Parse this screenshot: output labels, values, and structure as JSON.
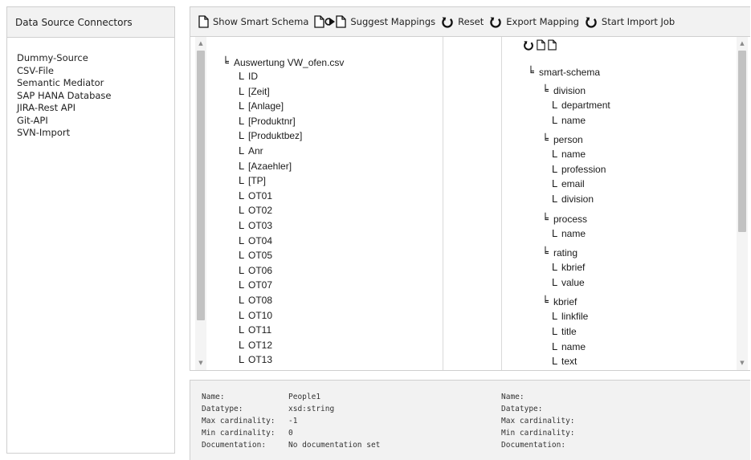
{
  "sidebar": {
    "title": "Data Source Connectors",
    "items": [
      "Dummy-Source",
      "CSV-File",
      "Semantic Mediator",
      "SAP HANA Database",
      "JIRA-Rest API",
      "Git-API",
      "SVN-Import"
    ]
  },
  "toolbar": {
    "show_smart_schema": "Show Smart Schema",
    "suggest_mappings": "Suggest Mappings",
    "reset": "Reset",
    "export_mapping": "Export Mapping",
    "start_import_job": "Start Import Job"
  },
  "source_tree": {
    "root": "Auswertung VW_ofen.csv",
    "children": [
      "ID",
      "[Zeit]",
      "[Anlage]",
      "[Produktnr]",
      "[Produktbez]",
      "Anr",
      "[Azaehler]",
      "[TP]",
      "OT01",
      "OT02",
      "OT03",
      "OT04",
      "OT05",
      "OT06",
      "OT07",
      "OT08",
      "OT10",
      "OT11",
      "OT12",
      "OT13"
    ]
  },
  "target_tree": {
    "root": "smart-schema",
    "groups": [
      {
        "name": "division",
        "children": [
          "department",
          "name"
        ]
      },
      {
        "name": "person",
        "children": [
          "name",
          "profession",
          "email",
          "division"
        ]
      },
      {
        "name": "process",
        "children": [
          "name"
        ]
      },
      {
        "name": "rating",
        "children": [
          "kbrief",
          "value"
        ]
      },
      {
        "name": "kbrief",
        "children": [
          "linkfile",
          "title",
          "name",
          "text"
        ]
      }
    ]
  },
  "source_info": {
    "labels": [
      "Name:",
      "Datatype:",
      "Max cardinality:",
      "Min cardinality:",
      "Documentation:"
    ],
    "values": [
      "People1",
      "xsd:string",
      "-1",
      "0",
      "No documentation set"
    ]
  },
  "target_info": {
    "labels": [
      "Name:",
      "Datatype:",
      "Max cardinality:",
      "Min cardinality:",
      "Documentation:"
    ]
  },
  "icons": {
    "document": "document-icon",
    "reset": "reset-icon",
    "tree_branch": "tree-branch-icon",
    "tree_leaf": "tree-leaf-icon"
  },
  "colors": {
    "panel_header": "#f2f2f2",
    "border": "#cfcfcf",
    "scroll_thumb": "#c2c2c2"
  }
}
